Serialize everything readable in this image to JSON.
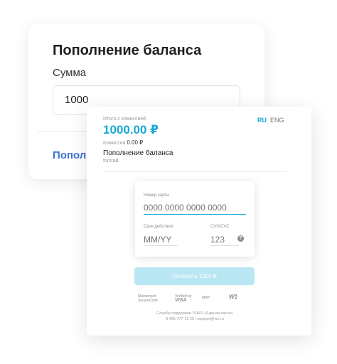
{
  "back_card": {
    "title": "Пополнение баланса",
    "sum_label": "Сумма",
    "sum_value": "1000",
    "link_text": "Пополн"
  },
  "payment": {
    "total_label": "Итого с комиссией",
    "total_amount": "1000.00 ₽",
    "commission_label": "Комиссия",
    "commission_value": "0.00 ₽",
    "purpose": "Пополнение баланса",
    "merchant": "forstad",
    "languages": {
      "ru": "RU",
      "eng": "ENG"
    },
    "card_number_label": "Номер карты",
    "card_number_placeholder": "0000 0000 0000 0000",
    "expiry_label": "Срок действия",
    "expiry_placeholder": "MM/YY",
    "cvv_label": "CVV/CVC",
    "cvv_placeholder": "123",
    "help_glyph": "?",
    "pay_button": "Оплатить 1000 ₽",
    "logos": {
      "mastercard": "Mastercard SecureCode",
      "visa_top": "Verified by",
      "visa": "VISA",
      "mir": "МИР",
      "w1": "W1"
    },
    "support_line1": "Служба поддержки РНКО «Единая касса»",
    "support_line2": "8 495 777-11-25 | support@w1.ru"
  },
  "colors": {
    "accent": "#1aa7d6",
    "link": "#3b73d6",
    "button_disabled": "#b9e6f3"
  }
}
